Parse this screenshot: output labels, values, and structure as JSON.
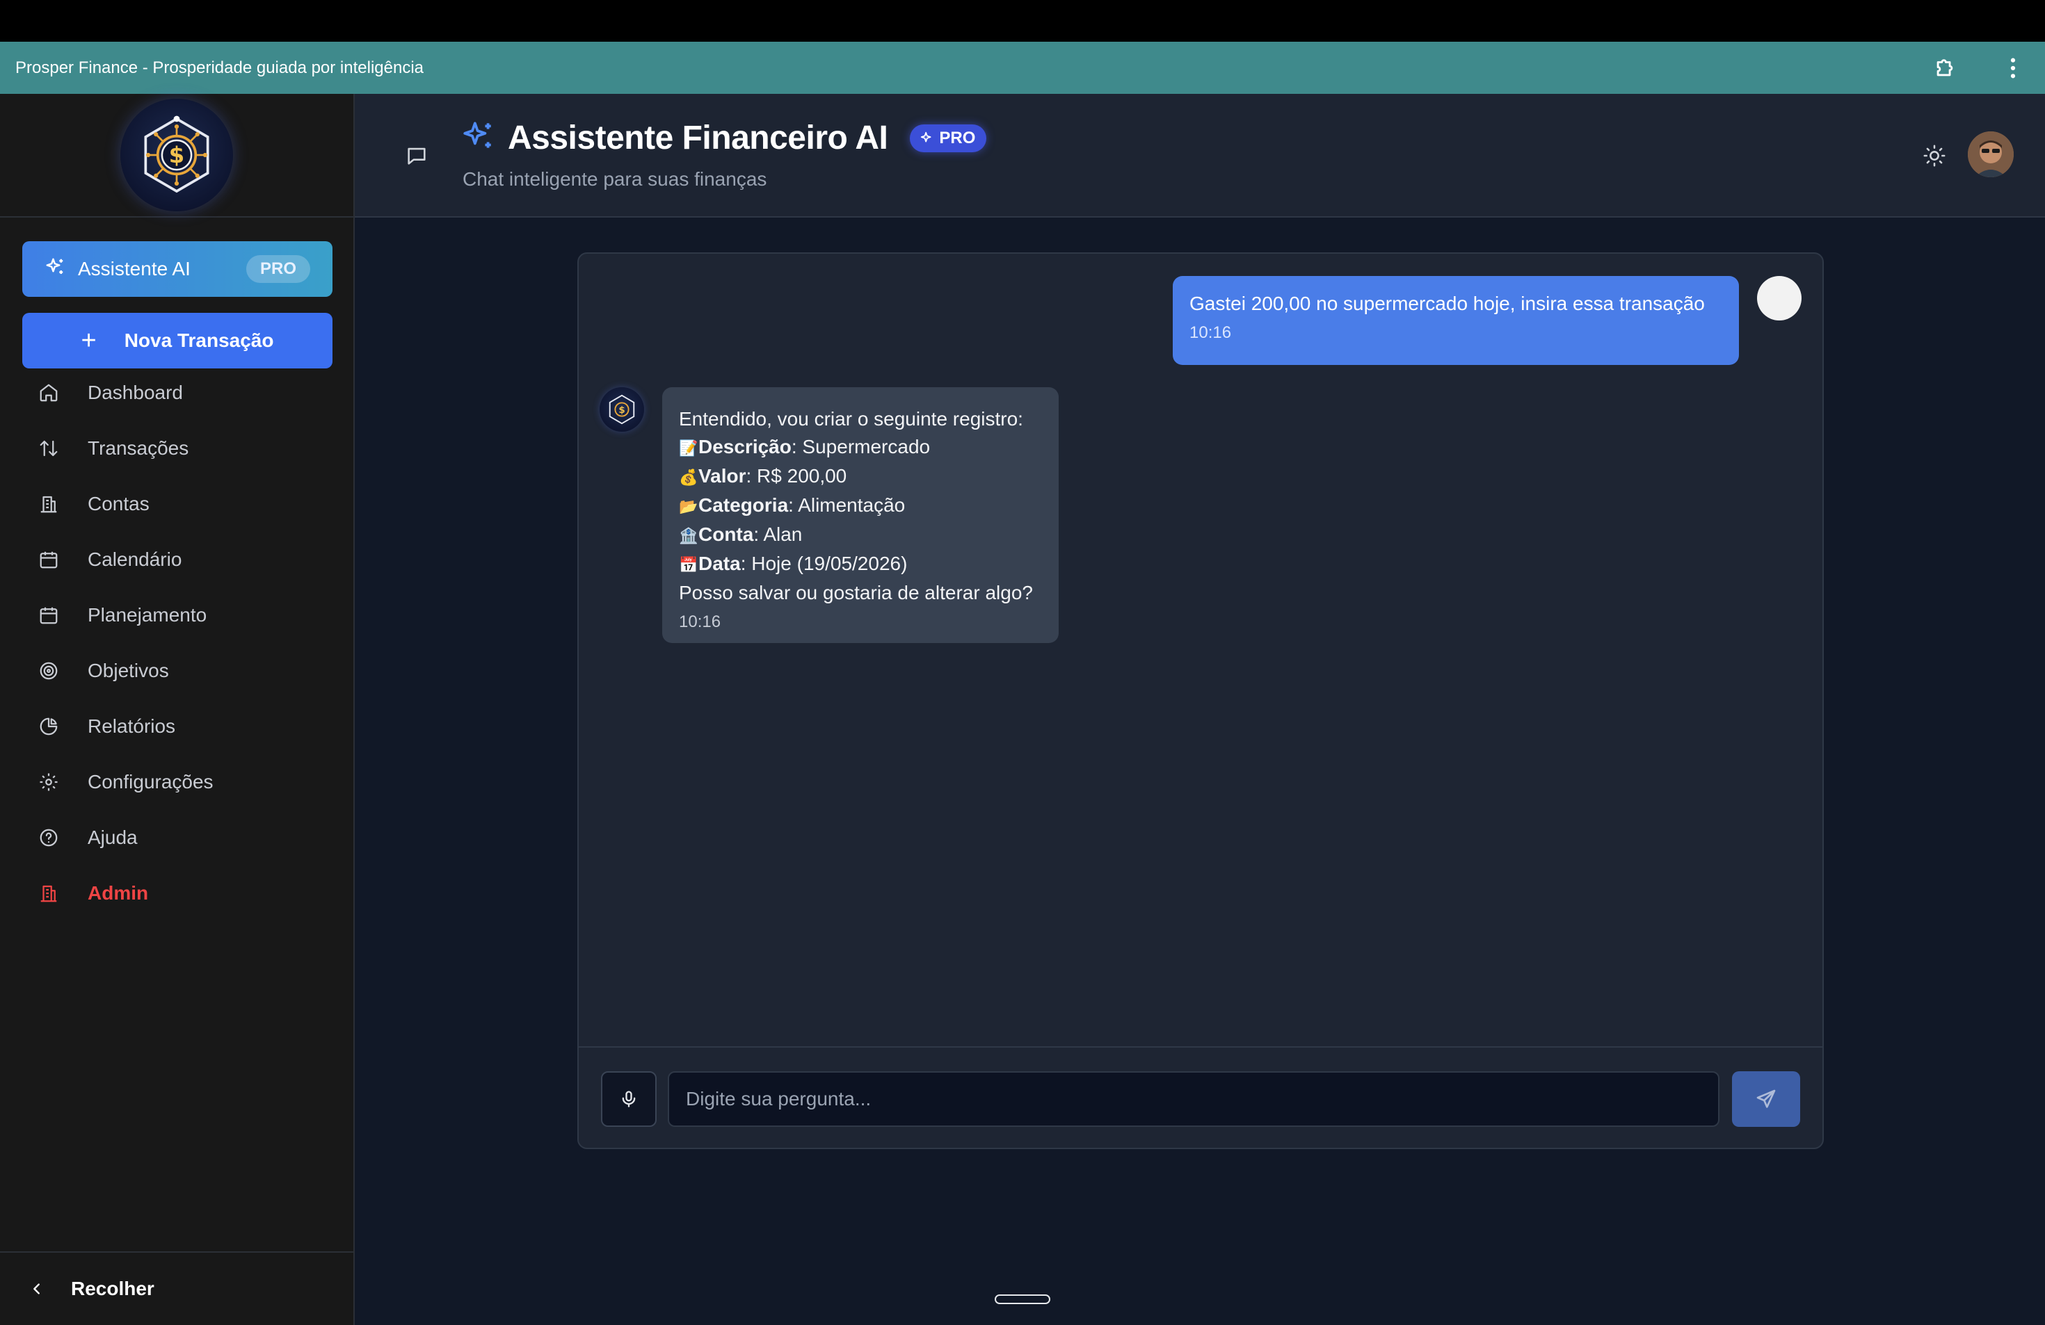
{
  "window": {
    "title": "Prosper Finance - Prosperidade guiada por inteligência"
  },
  "sidebar": {
    "ai_button": {
      "label": "Assistente AI",
      "badge": "PRO"
    },
    "new_button": {
      "icon": "+",
      "label": "Nova Transação"
    },
    "items": [
      {
        "label": "Dashboard",
        "icon": "home-icon"
      },
      {
        "label": "Transações",
        "icon": "arrows-updown-icon"
      },
      {
        "label": "Contas",
        "icon": "building-icon"
      },
      {
        "label": "Calendário",
        "icon": "calendar-icon"
      },
      {
        "label": "Planejamento",
        "icon": "calendar-icon"
      },
      {
        "label": "Objetivos",
        "icon": "target-icon"
      },
      {
        "label": "Relatórios",
        "icon": "pie-chart-icon"
      },
      {
        "label": "Configurações",
        "icon": "gear-icon"
      },
      {
        "label": "Ajuda",
        "icon": "help-circle-icon"
      },
      {
        "label": "Admin",
        "icon": "building-icon"
      }
    ],
    "collapse_label": "Recolher"
  },
  "header": {
    "title": "Assistente Financeiro AI",
    "badge": "PRO",
    "subtitle": "Chat inteligente para suas finanças"
  },
  "chat": {
    "user_message": {
      "text": "Gastei 200,00 no supermercado hoje, insira essa transação",
      "time": "10:16"
    },
    "bot_message": {
      "intro": "Entendido, vou criar o seguinte registro:",
      "fields": [
        {
          "emoji": "📝",
          "key": "Descrição",
          "value": ": Supermercado"
        },
        {
          "emoji": "💰",
          "key": "Valor",
          "value": ": R$ 200,00"
        },
        {
          "emoji": "📂",
          "key": "Categoria",
          "value": ": Alimentação"
        },
        {
          "emoji": "🏦",
          "key": "Conta",
          "value": ": Alan"
        },
        {
          "emoji": "📅",
          "key": "Data",
          "value": ": Hoje (19/05/2026)"
        }
      ],
      "question": "Posso salvar ou gostaria de alterar algo?",
      "time": "10:16"
    },
    "input": {
      "placeholder": "Digite sua pergunta...",
      "value": ""
    }
  },
  "colors": {
    "accent": "#3b6ff0",
    "titlebar": "#3f8a8c",
    "admin": "#ef4444",
    "user_bubble": "#4a7de8",
    "bot_bubble": "#374151"
  }
}
